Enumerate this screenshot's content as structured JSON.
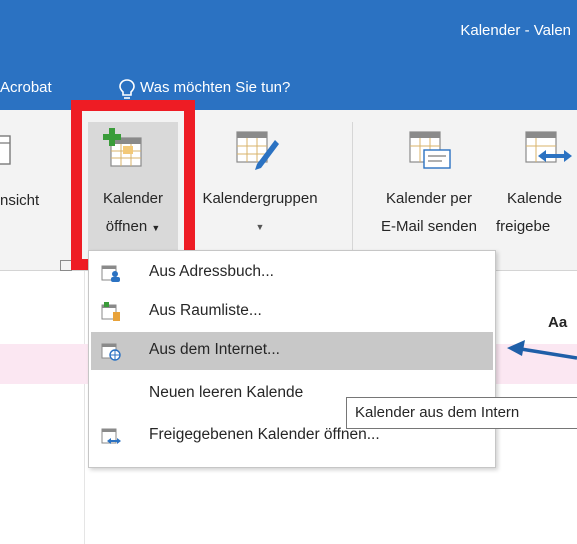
{
  "window": {
    "title": "Kalender - Valen"
  },
  "tabs": {
    "acrobat": "Acrobat",
    "tell_me": "Was möchten Sie tun?"
  },
  "ribbon": {
    "ansicht": "nsicht",
    "open_calendar": {
      "line1": "Kalender",
      "line2": "öffnen"
    },
    "calendar_groups": {
      "line1": "Kalendergruppen"
    },
    "email_calendar": {
      "line1": "Kalender per",
      "line2": "E-Mail senden"
    },
    "share_calendar": {
      "line1": "Kalende",
      "line2": "freigebe"
    }
  },
  "dropdown": {
    "items": [
      {
        "label": "Aus Adressbuch...",
        "icon": "address-book-calendar-icon"
      },
      {
        "label": "Aus Raumliste...",
        "icon": "room-list-calendar-icon"
      },
      {
        "label": "Aus dem Internet...",
        "icon": "internet-calendar-icon"
      },
      {
        "label": "Neuen leeren Kalende",
        "icon": ""
      },
      {
        "label": "Freigegebenen Kalender öffnen...",
        "icon": "shared-calendar-icon"
      }
    ]
  },
  "tooltip": {
    "text": "Kalender aus dem Intern"
  },
  "main": {
    "column_label": "Aa"
  },
  "colors": {
    "titlebar": "#2b72c2",
    "highlight": "#ee1c24",
    "arrow": "#1f5fa8",
    "selected": "#c8c8c8"
  }
}
